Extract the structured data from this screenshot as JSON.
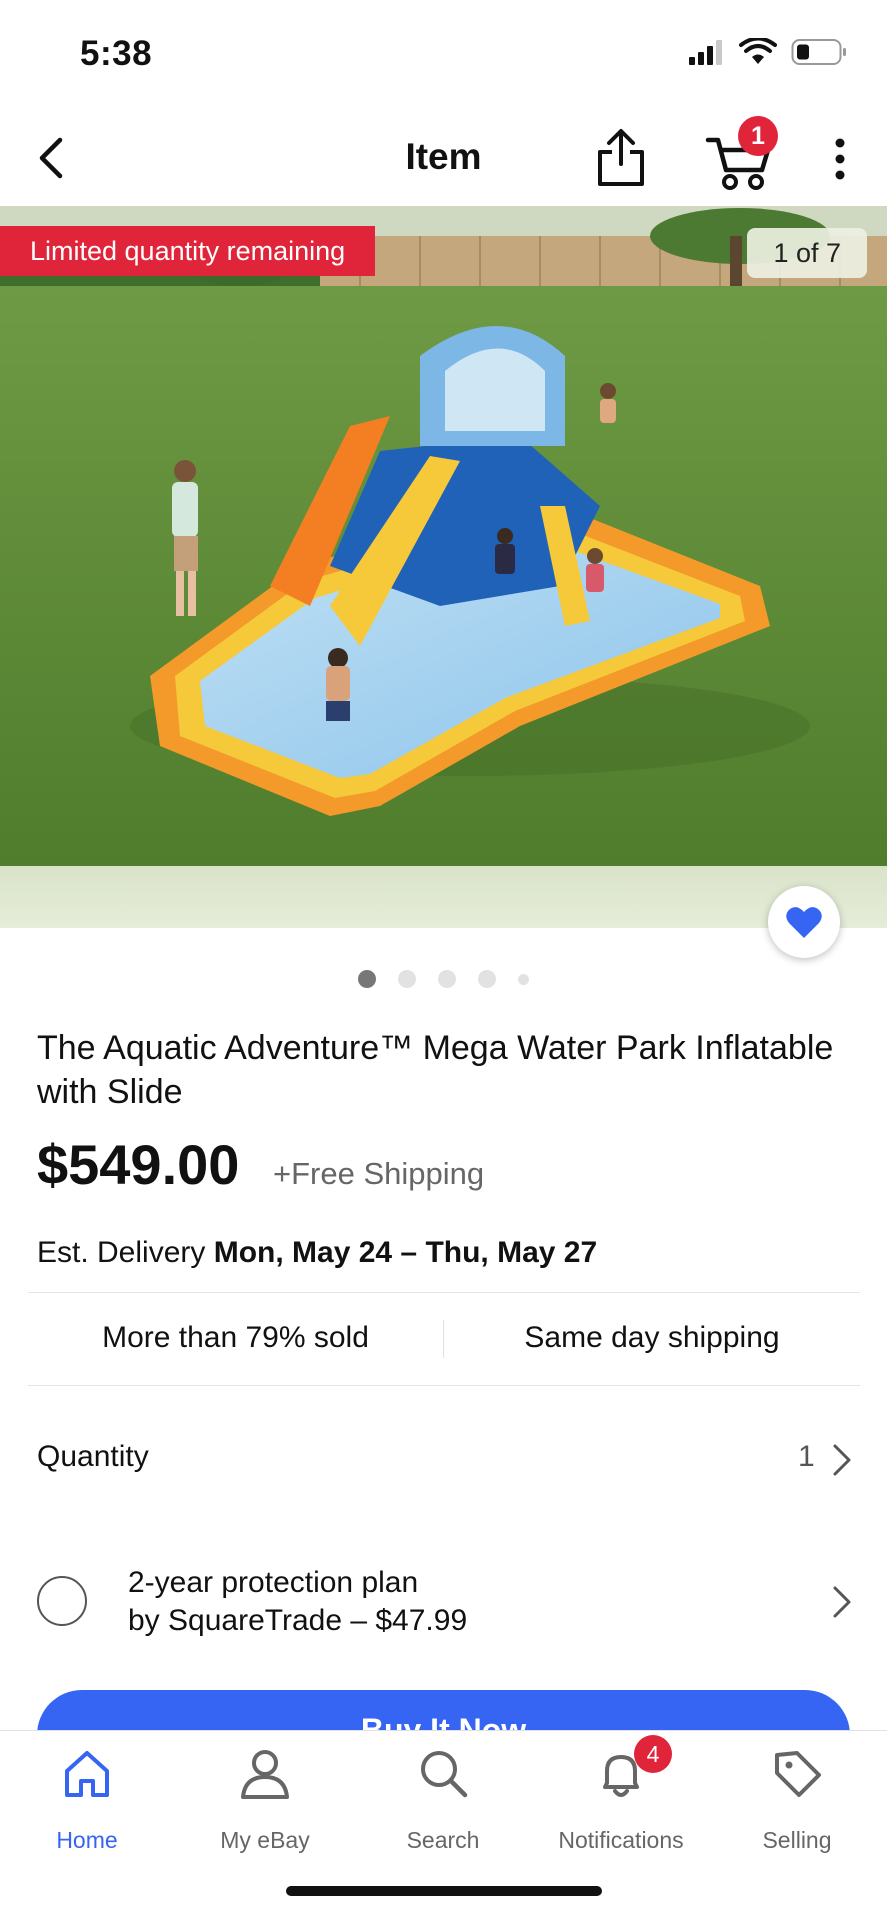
{
  "status_bar": {
    "time": "5:38"
  },
  "nav": {
    "title": "Item",
    "cart_count": "1"
  },
  "hero": {
    "badge": "Limited quantity remaining",
    "photo_count": "1 of 7"
  },
  "item": {
    "title": "The Aquatic Adventure™ Mega Water Park Inflatable  with Slide",
    "price": "$549.00",
    "shipping": "+Free Shipping",
    "delivery_label": "Est. Delivery",
    "delivery_dates": "Mon, May 24 – Thu, May 27"
  },
  "stats": {
    "sold": "More than 79% sold",
    "shipping": "Same day shipping"
  },
  "quantity": {
    "label": "Quantity",
    "value": "1"
  },
  "protection_plan": {
    "line1": "2-year protection plan",
    "line2": "by SquareTrade – $47.99"
  },
  "buy_button": {
    "label": "Buy It Now"
  },
  "tabs": [
    {
      "label": "Home",
      "icon": "home-icon",
      "active": true
    },
    {
      "label": "My eBay",
      "icon": "person-icon"
    },
    {
      "label": "Search",
      "icon": "search-icon"
    },
    {
      "label": "Notifications",
      "icon": "bell-icon",
      "badge": "4"
    },
    {
      "label": "Selling",
      "icon": "tag-icon"
    }
  ],
  "colors": {
    "accent": "#3665f3",
    "badge_red": "#e0243a"
  }
}
